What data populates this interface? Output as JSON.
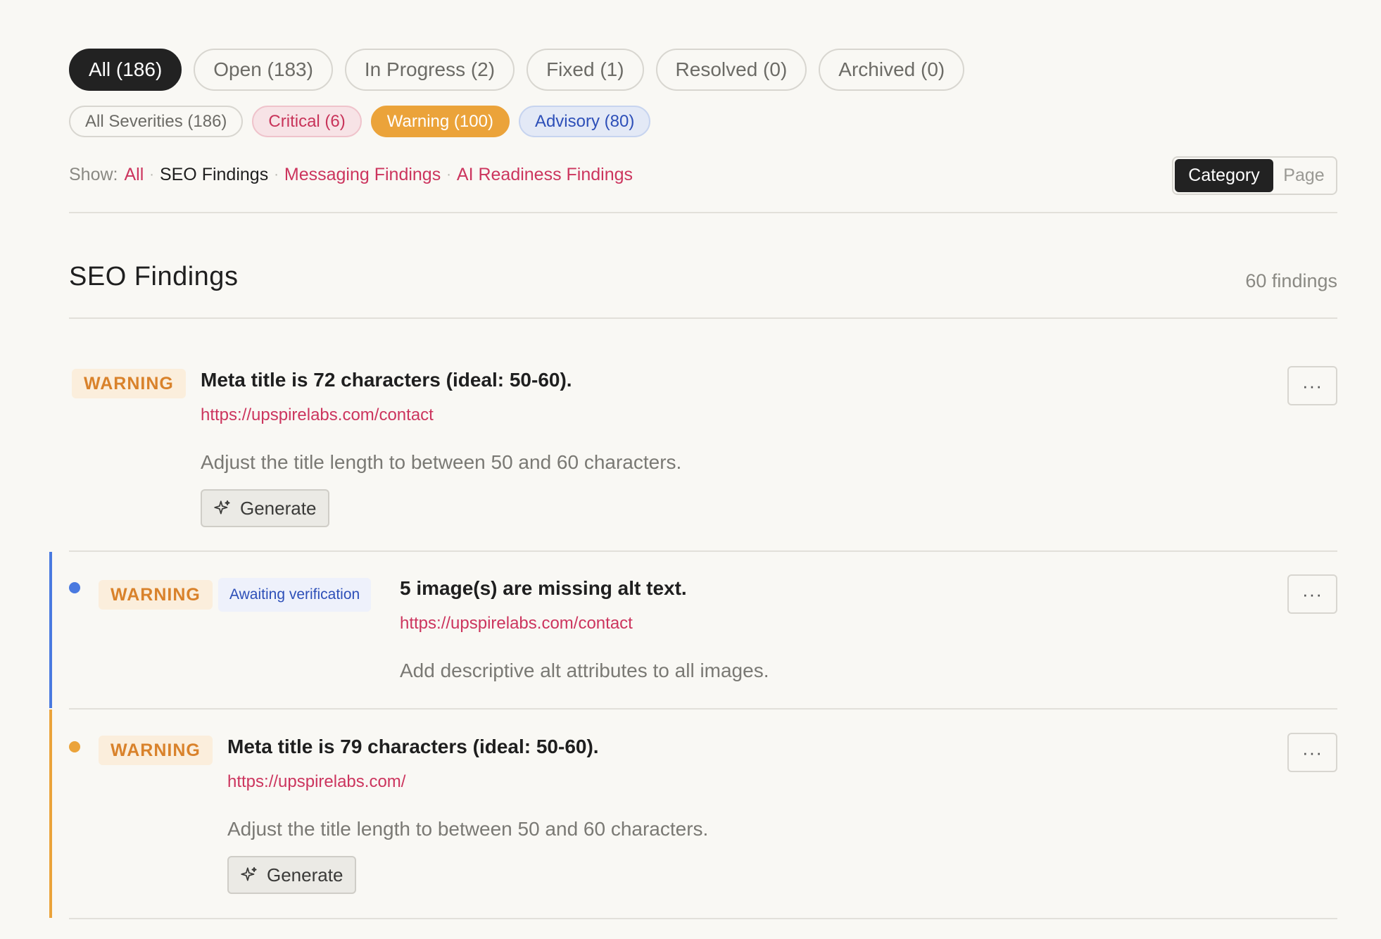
{
  "status_filters": [
    {
      "label": "All (186)",
      "active": true
    },
    {
      "label": "Open (183)",
      "active": false
    },
    {
      "label": "In Progress (2)",
      "active": false
    },
    {
      "label": "Fixed (1)",
      "active": false
    },
    {
      "label": "Resolved (0)",
      "active": false
    },
    {
      "label": "Archived (0)",
      "active": false
    }
  ],
  "severity_filters": [
    {
      "label": "All Severities (186)"
    },
    {
      "label": "Critical (6)"
    },
    {
      "label": "Warning (100)"
    },
    {
      "label": "Advisory (80)"
    }
  ],
  "show": {
    "label": "Show:",
    "options": [
      "All",
      "SEO Findings",
      "Messaging Findings",
      "AI Readiness Findings"
    ],
    "current": "SEO Findings"
  },
  "view_toggle": {
    "options": [
      "Category",
      "Page"
    ],
    "selected": "Category"
  },
  "section": {
    "title": "SEO Findings",
    "count": "60 findings"
  },
  "findings": [
    {
      "severity": "WARNING",
      "status_badge": "",
      "title": "Meta title is 72 characters (ideal: 50-60).",
      "url": "https://upspirelabs.com/contact",
      "description": "Adjust the title length to between 50 and 60 characters.",
      "action": "Generate",
      "more": "···"
    },
    {
      "severity": "WARNING",
      "status_badge": "Awaiting verification",
      "title": "5 image(s) are missing alt text.",
      "url": "https://upspirelabs.com/contact",
      "description": "Add descriptive alt attributes to all images.",
      "action": "",
      "more": "···",
      "indicator_color": "#4a7ae0"
    },
    {
      "severity": "WARNING",
      "status_badge": "",
      "title": "Meta title is 79 characters (ideal: 50-60).",
      "url": "https://upspirelabs.com/",
      "description": "Adjust the title length to between 50 and 60 characters.",
      "action": "Generate",
      "more": "···",
      "indicator_color": "#eba33a"
    }
  ],
  "colors": {
    "accent_link": "#cc355e",
    "warning": "#eba33a",
    "advisory": "#2d4fb8",
    "critical": "#c8345a"
  }
}
